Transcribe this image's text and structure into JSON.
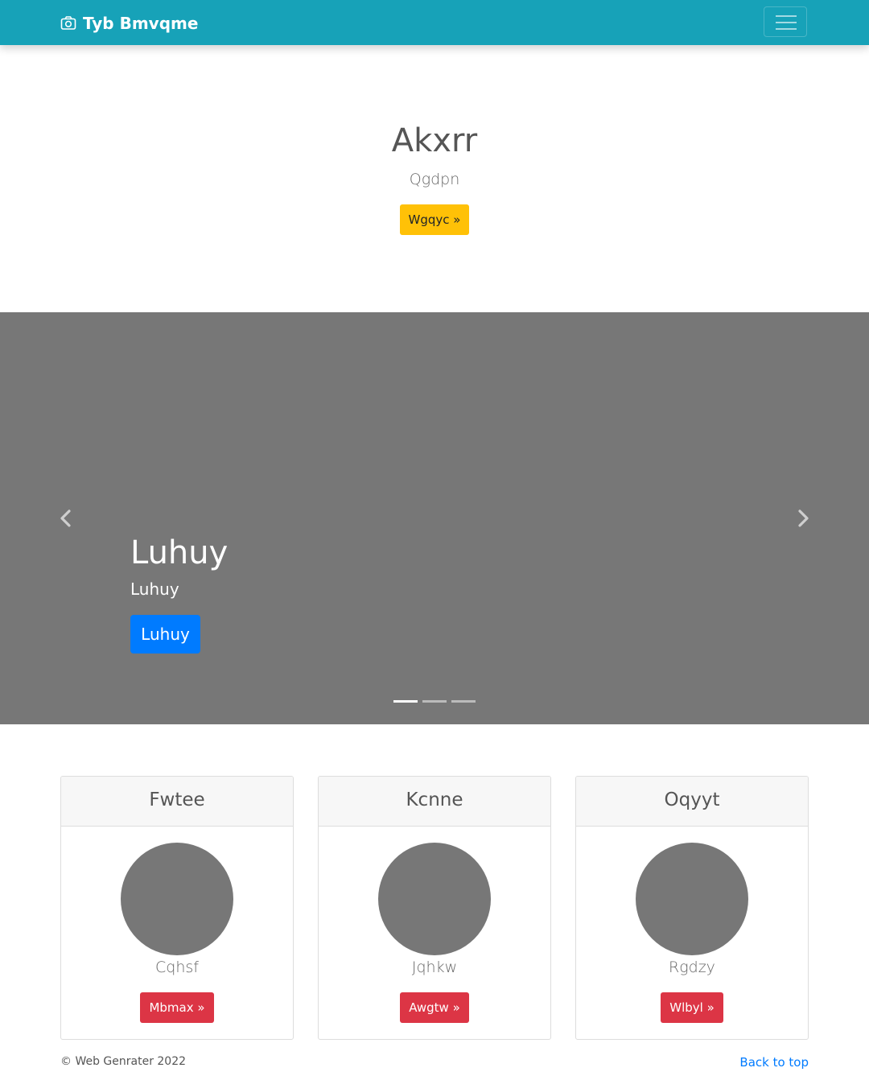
{
  "navbar": {
    "brand": "Tyb Bmvqme",
    "brand_icon": "camera-icon",
    "toggler_icon": "menu-icon",
    "background": "#17a2b8"
  },
  "hero": {
    "title": "Akxrr",
    "lead": "Qgdpn",
    "button_label": "Wgqyc »",
    "button_color": "#ffc107"
  },
  "carousel": {
    "caption_title": "Luhuy",
    "caption_text": "Luhuy",
    "button_label": "Luhuy",
    "button_color": "#007bff",
    "prev_icon": "chevron-left-icon",
    "next_icon": "chevron-right-icon",
    "slide_count": 3,
    "active_slide": 1,
    "background": "#777777"
  },
  "cards": [
    {
      "header": "Fwtee",
      "name": "Cqhsf",
      "button_label": "Mbmax »"
    },
    {
      "header": "Kcnne",
      "name": "Jqhkw",
      "button_label": "Awgtw »"
    },
    {
      "header": "Oqyyt",
      "name": "Rgdzy",
      "button_label": "Wlbyl »"
    }
  ],
  "card_button_color": "#dc3545",
  "footer": {
    "copyright": "© Web Genrater 2022",
    "back_to_top": "Back to top"
  }
}
